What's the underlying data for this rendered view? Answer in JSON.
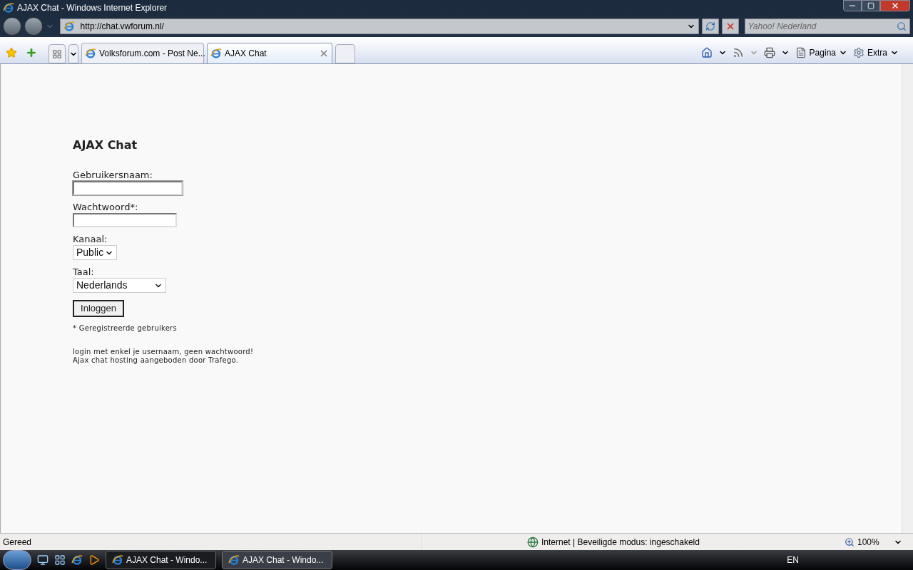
{
  "window": {
    "title": "AJAX Chat - Windows Internet Explorer"
  },
  "address_bar": {
    "url": "http://chat.vwforum.nl/"
  },
  "search": {
    "placeholder": "Yahoo! Nederland"
  },
  "tabs": [
    {
      "label": "Volksforum.com - Post Ne...",
      "selected": false
    },
    {
      "label": "AJAX Chat",
      "selected": true
    }
  ],
  "command_bar": [
    {
      "label": "Pagina"
    },
    {
      "label": "Extra"
    }
  ],
  "page": {
    "heading": "AJAX Chat",
    "fields": [
      {
        "kind": "text",
        "label": "Gebruikersnaam:",
        "focused": true
      },
      {
        "kind": "password",
        "label": "Wachtwoord*:",
        "focused": false
      },
      {
        "kind": "select",
        "label": "Kanaal:",
        "value": "Public"
      },
      {
        "kind": "select",
        "label": "Taal:",
        "value": "Nederlands"
      }
    ],
    "submit": "Inloggen",
    "footnote": "* Geregistreerde gebruikers",
    "notes": [
      "login met enkel je usernaam, geen wachtwoord!",
      "Ajax chat hosting aangeboden door Trafego."
    ]
  },
  "status_bar": {
    "status": "Gereed",
    "zone": "Internet | Beveiligde modus: ingeschakeld",
    "zoom": "100%"
  },
  "taskbar": {
    "buttons": [
      {
        "label": "AJAX Chat - Windo...",
        "selected": true
      },
      {
        "label": "AJAX Chat - Windo...",
        "selected": false
      }
    ],
    "language": "EN"
  }
}
